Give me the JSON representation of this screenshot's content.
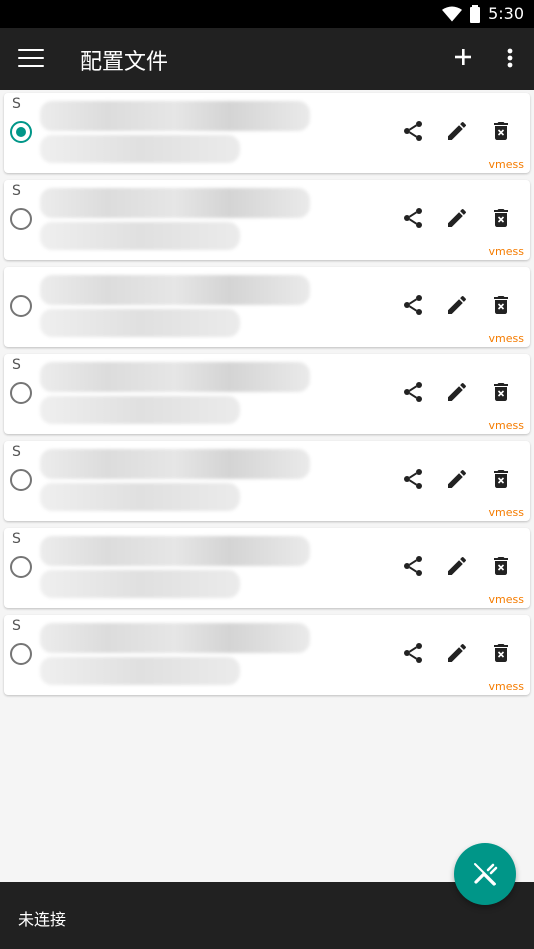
{
  "status_bar": {
    "time": "5:30"
  },
  "appbar": {
    "title": "配置文件"
  },
  "profiles": [
    {
      "prefix": "S",
      "protocol": "vmess",
      "selected": true
    },
    {
      "prefix": "S",
      "protocol": "vmess",
      "selected": false
    },
    {
      "prefix": "",
      "protocol": "vmess",
      "selected": false
    },
    {
      "prefix": "S",
      "protocol": "vmess",
      "selected": false
    },
    {
      "prefix": "S",
      "protocol": "vmess",
      "selected": false
    },
    {
      "prefix": "S",
      "protocol": "vmess",
      "selected": false
    },
    {
      "prefix": "S",
      "protocol": "vmess",
      "selected": false
    }
  ],
  "bottom": {
    "connection_status": "未连接"
  },
  "colors": {
    "accent": "#009688",
    "protocol": "#f57c00",
    "bars": "#212121"
  },
  "icons": [
    "menu-icon",
    "add-icon",
    "more-vert-icon",
    "share-icon",
    "edit-icon",
    "delete-icon",
    "fab-connect-icon",
    "wifi-icon",
    "battery-icon"
  ]
}
